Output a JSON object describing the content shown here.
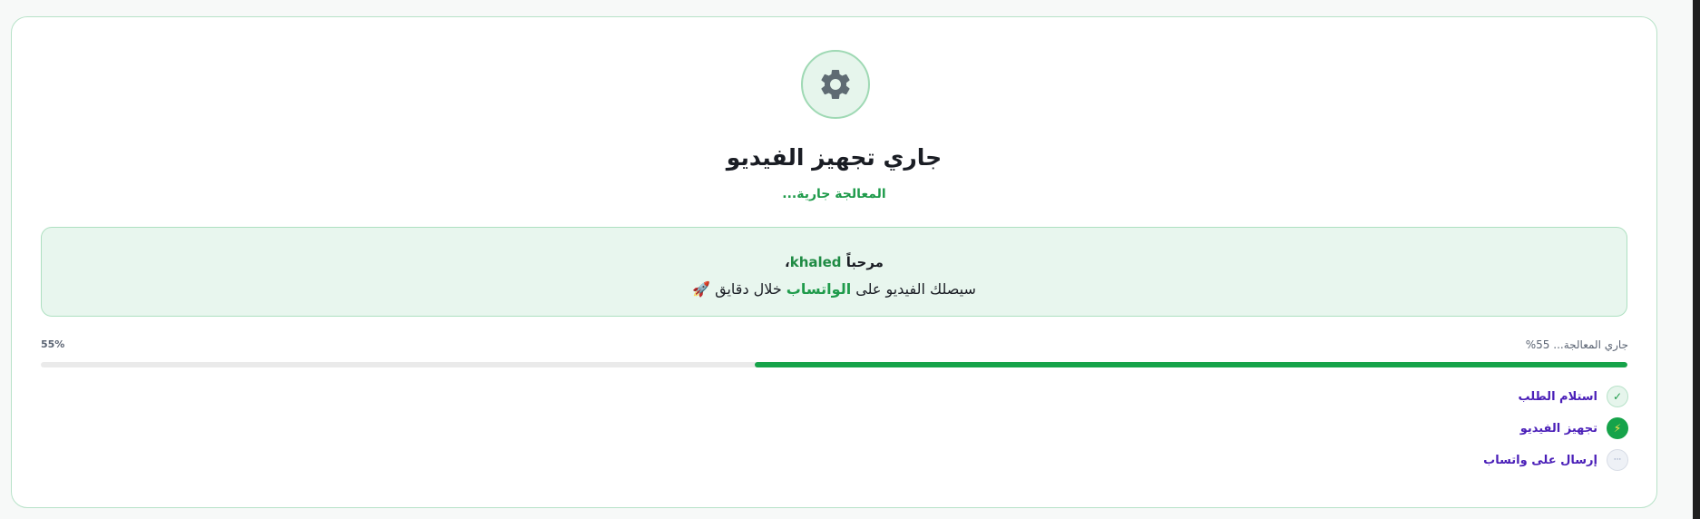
{
  "header": {
    "status_icon": "gear-icon",
    "title": "جاري تجهيز الفيديو",
    "subtitle": "المعالجة جارية..."
  },
  "welcome": {
    "greeting": "مرحباً ",
    "name": "khaled",
    "comma": "،",
    "message_prefix": "سيصلك الفيديو على ",
    "message_highlight": "الواتساب",
    "message_suffix": " خلال دقايق ",
    "message_emoji": "🚀"
  },
  "progress": {
    "label": "جاري المعالجة... 55%",
    "percent_label": "55%",
    "value": 55,
    "fill_color": "#16a34a"
  },
  "steps": [
    {
      "label": "استلام الطلب",
      "state": "done",
      "icon": "checkmark-icon",
      "glyph": "✓"
    },
    {
      "label": "تجهيز الفيديو",
      "state": "active",
      "icon": "lightning-icon",
      "glyph": "⚡"
    },
    {
      "label": "إرسال على واتساب",
      "state": "pending",
      "icon": "chat-dots-icon",
      "glyph": "···"
    }
  ],
  "colors": {
    "accent": "#16a34a",
    "accent_text": "#1f9b4b",
    "step_label": "#4a1fb8",
    "card_border": "#b7e2c8"
  }
}
